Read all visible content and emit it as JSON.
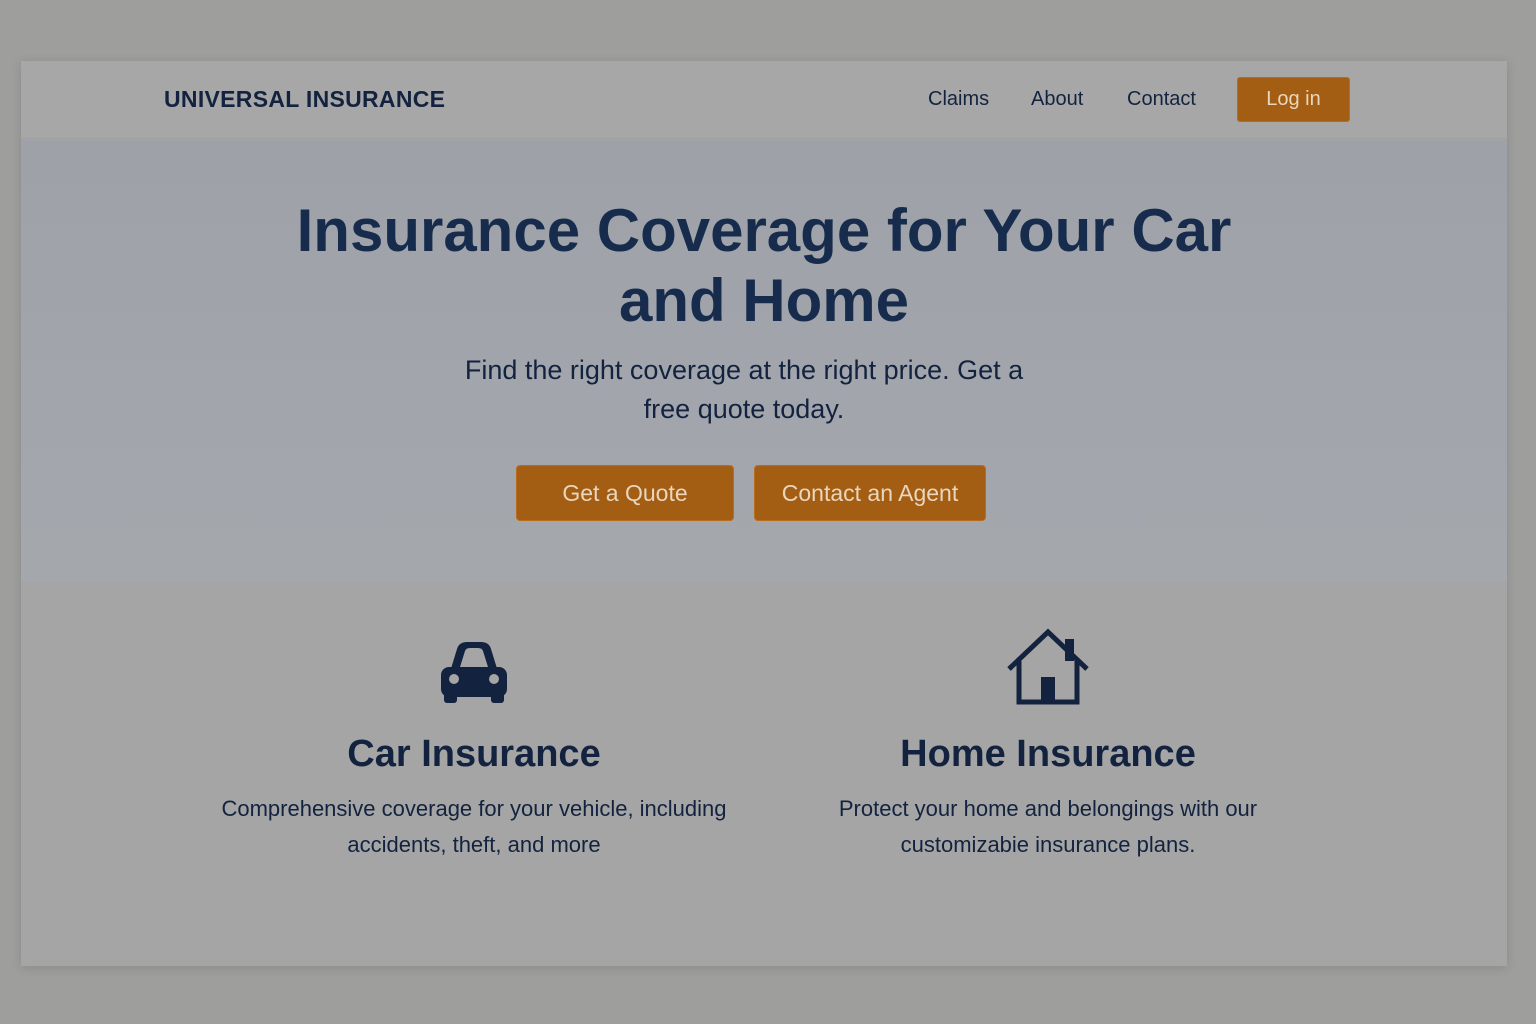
{
  "header": {
    "brand": "UNIVERSAL INSURANCE",
    "nav": {
      "claims": "Claims",
      "about": "About",
      "contact": "Contact"
    },
    "login_label": "Log in"
  },
  "hero": {
    "title": "Insurance Coverage for Your Car and Home",
    "subtitle": "Find the right coverage at the right price. Get a free quote today.",
    "primary_cta": "Get a Quote",
    "secondary_cta": "Contact an Agent"
  },
  "features": {
    "car": {
      "icon": "car-icon",
      "title": "Car Insurance",
      "description": "Comprehensive coverage for your vehicle, including accidents, theft, and more"
    },
    "home": {
      "icon": "house-icon",
      "title": "Home Insurance",
      "description": "Protect your home and belongings with our customizabie insurance plans."
    }
  },
  "colors": {
    "accent": "#a45e14",
    "text": "#13233f",
    "background": "#a5a5a5"
  }
}
